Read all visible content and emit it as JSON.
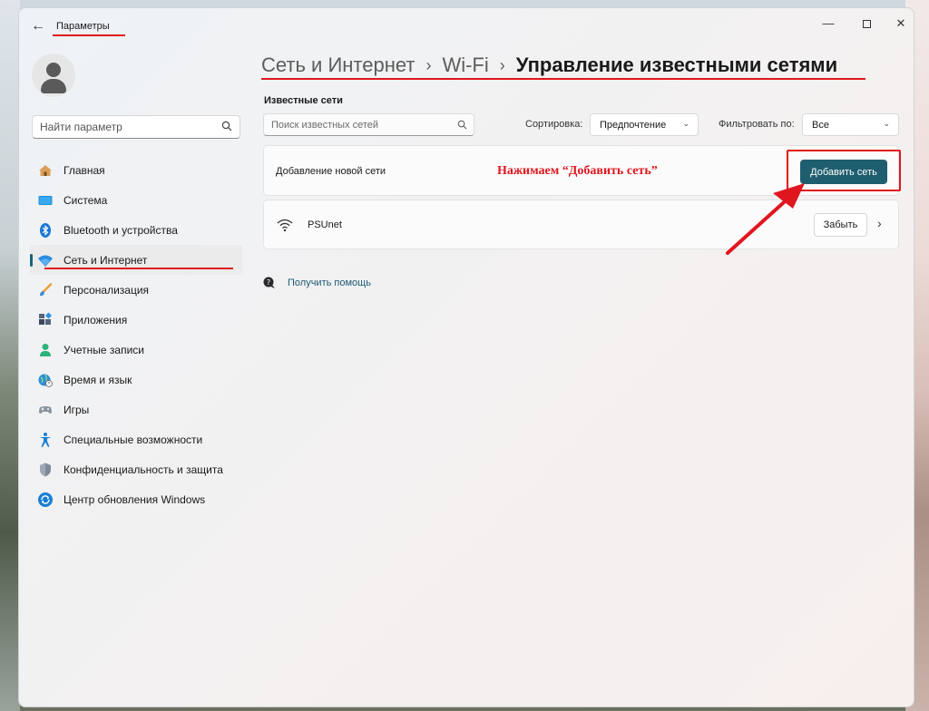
{
  "window": {
    "title": "Параметры"
  },
  "sidebar": {
    "search_placeholder": "Найти параметр",
    "items": [
      {
        "label": "Главная",
        "icon": "home-icon"
      },
      {
        "label": "Система",
        "icon": "monitor-icon"
      },
      {
        "label": "Bluetooth и устройства",
        "icon": "bluetooth-icon"
      },
      {
        "label": "Сеть и Интернет",
        "icon": "network-icon",
        "active": true
      },
      {
        "label": "Персонализация",
        "icon": "brush-icon"
      },
      {
        "label": "Приложения",
        "icon": "apps-icon"
      },
      {
        "label": "Учетные записи",
        "icon": "person-icon"
      },
      {
        "label": "Время и язык",
        "icon": "globe-icon"
      },
      {
        "label": "Игры",
        "icon": "gamepad-icon"
      },
      {
        "label": "Специальные возможности",
        "icon": "accessibility-icon"
      },
      {
        "label": "Конфиденциальность и защита",
        "icon": "shield-icon"
      },
      {
        "label": "Центр обновления Windows",
        "icon": "update-icon"
      }
    ]
  },
  "breadcrumb": {
    "items": [
      "Сеть и Интернет",
      "Wi-Fi"
    ],
    "current": "Управление известными сетями"
  },
  "known_networks": {
    "section_title": "Известные сети",
    "search_placeholder": "Поиск известных сетей",
    "sort_label": "Сортировка:",
    "sort_value": "Предпочтение",
    "filter_label": "Фильтровать по:",
    "filter_value": "Все",
    "add_network_label": "Добавление новой сети",
    "add_button_label": "Добавить сеть",
    "networks": [
      {
        "name": "PSUnet",
        "forget_label": "Забыть"
      }
    ]
  },
  "help": {
    "label": "Получить помощь"
  },
  "annotation": {
    "text": "Нажимаем “Добавить сеть”"
  },
  "colors": {
    "accent": "#1e5e6e",
    "annotation": "#e0161e",
    "link": "#1d5b73"
  }
}
